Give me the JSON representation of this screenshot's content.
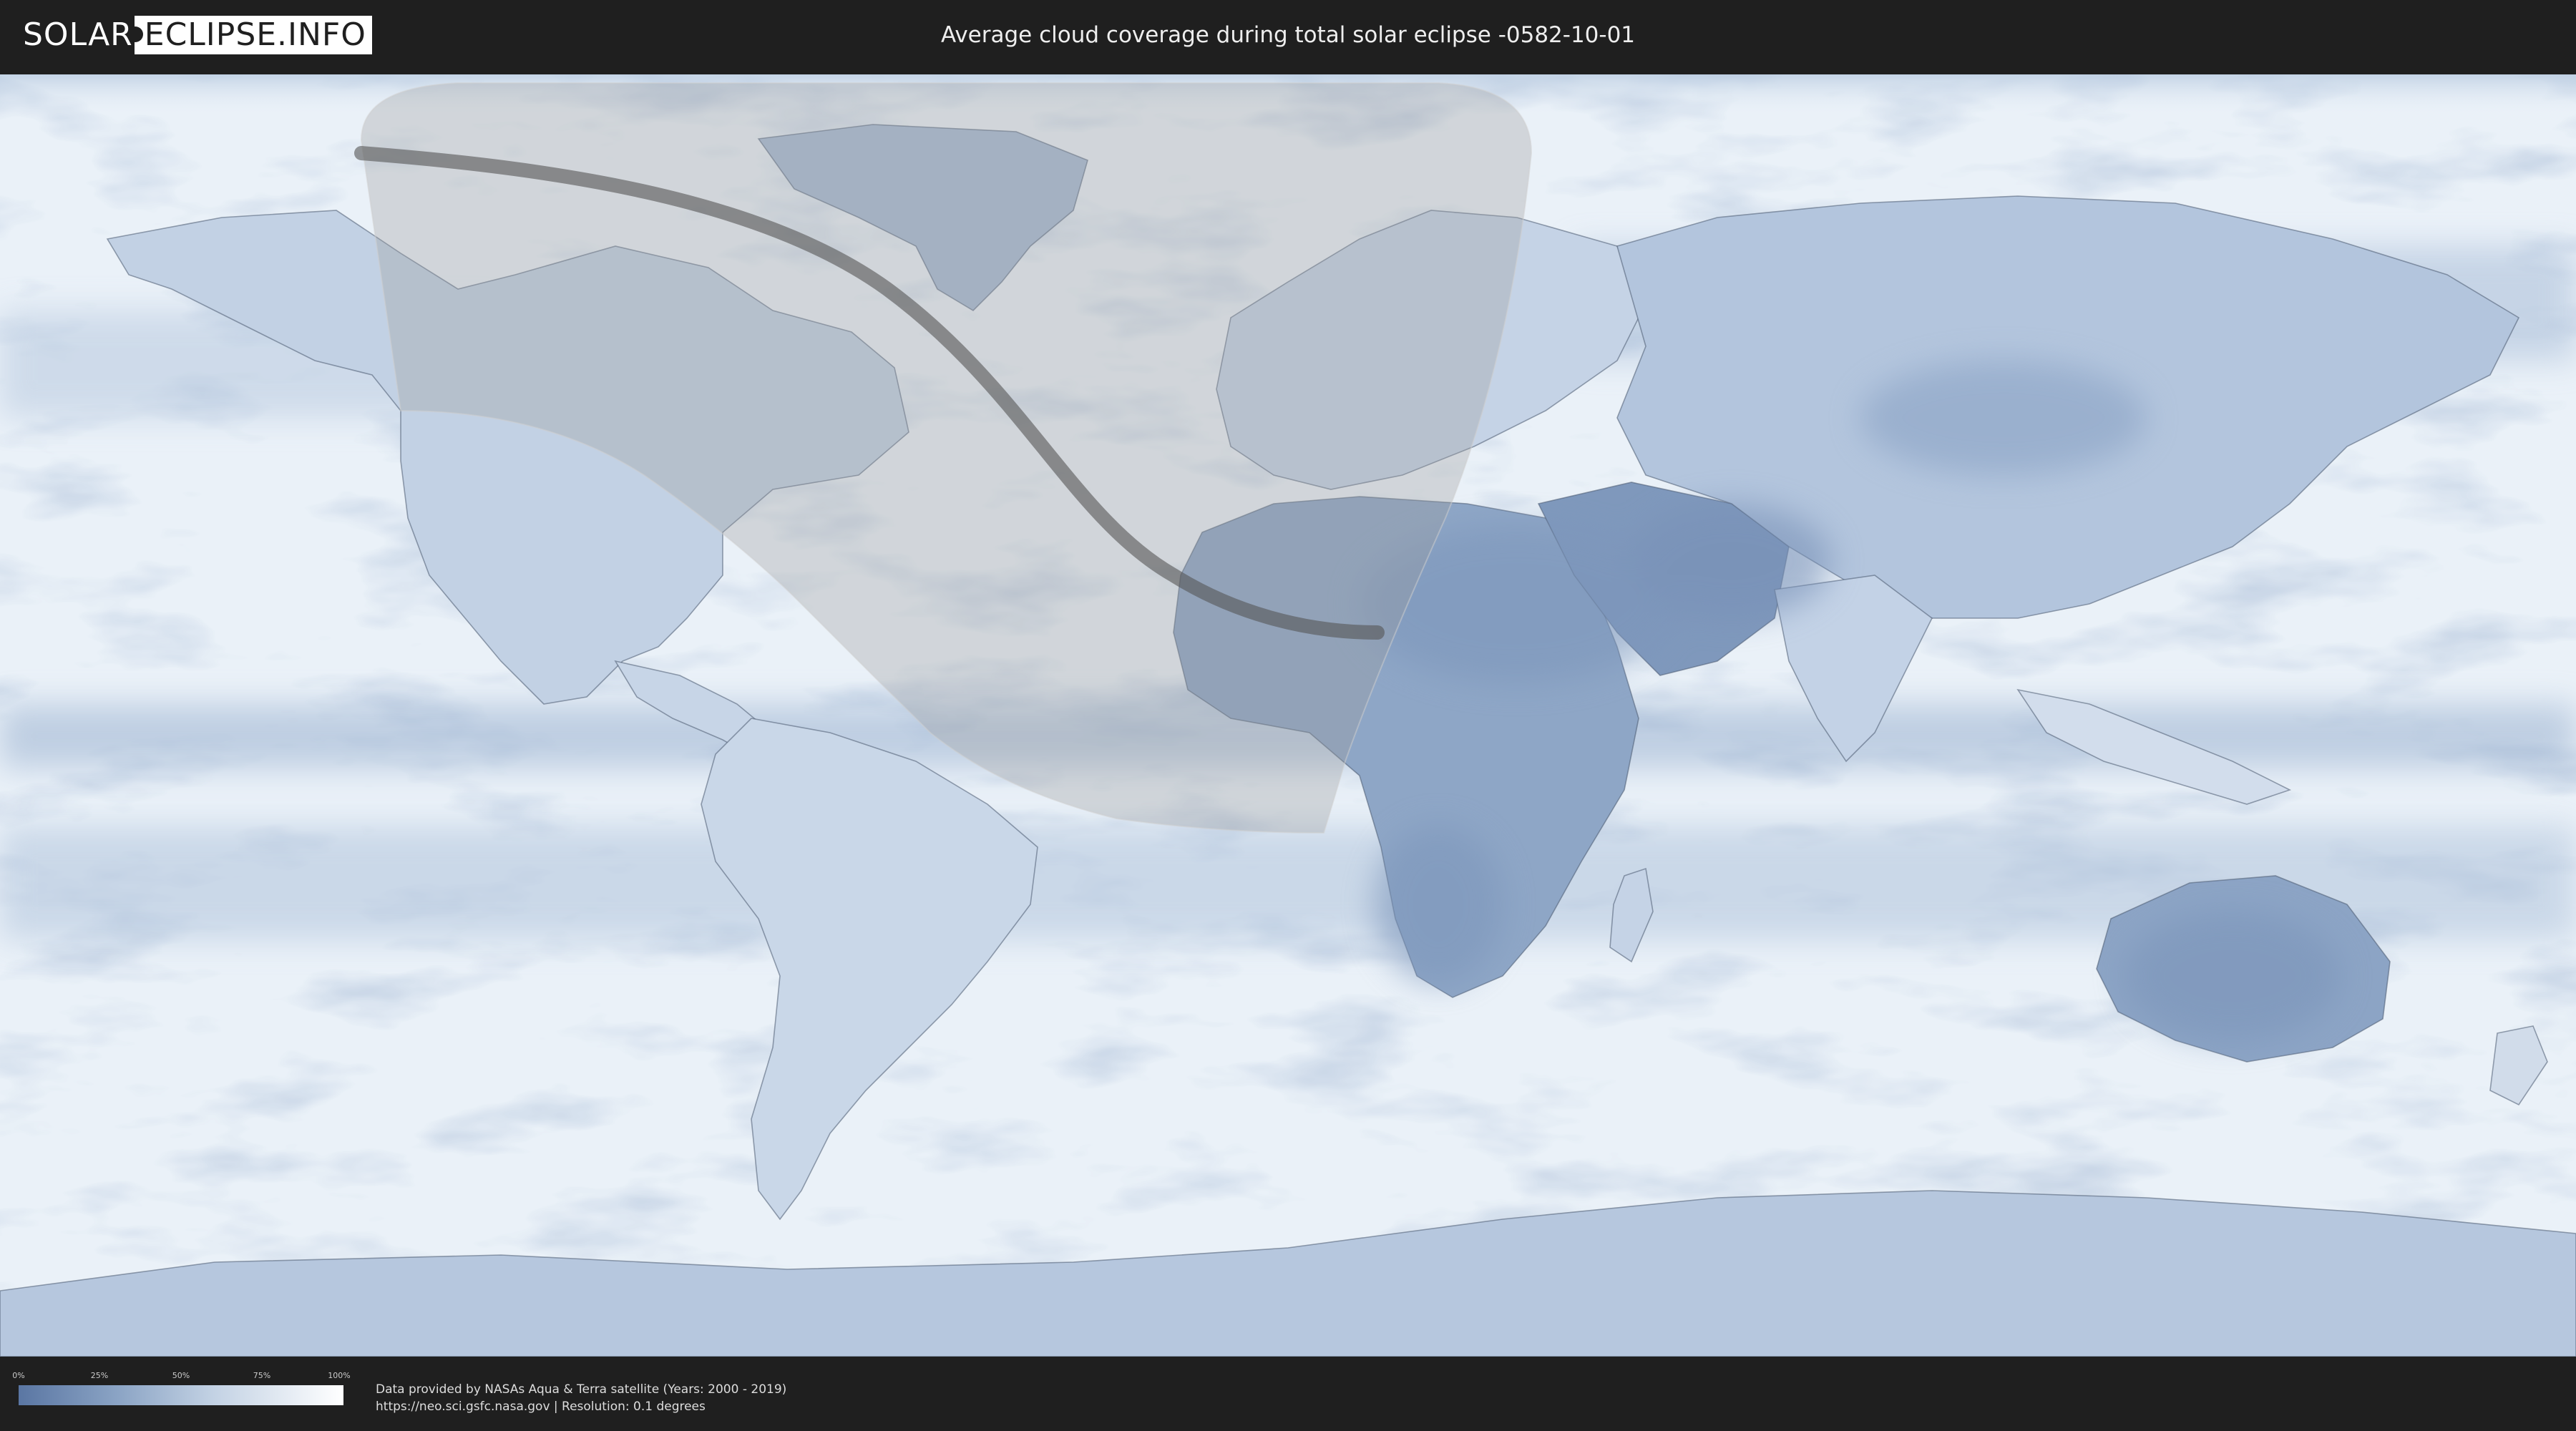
{
  "header": {
    "logo": {
      "part1": "SOLAR",
      "part2": "ECLIPSE.INFO"
    },
    "title": "Average cloud coverage during total solar eclipse -0582-10-01"
  },
  "map": {
    "colors": {
      "ocean_base": "#eef4fa",
      "cloud_white": "#ffffff",
      "clear_sky_blue": "#5a76a3",
      "eclipse_shadow": "#8c8c8c",
      "central_path": "#555555",
      "border_lines": "#4a5a70"
    },
    "features": [
      "eclipse-visibility-overlay",
      "total-eclipse-central-path",
      "cloud-coverage-base-map",
      "country-borders"
    ]
  },
  "footer": {
    "legend": {
      "ticks": [
        "0%",
        "25%",
        "50%",
        "75%",
        "100%"
      ],
      "gradient_start": "#5a76a3",
      "gradient_end": "#ffffff"
    },
    "credit_line1": "Data provided by NASAs Aqua & Terra satellite (Years: 2000 - 2019)",
    "credit_line2": "https://neo.sci.gsfc.nasa.gov | Resolution: 0.1 degrees"
  }
}
